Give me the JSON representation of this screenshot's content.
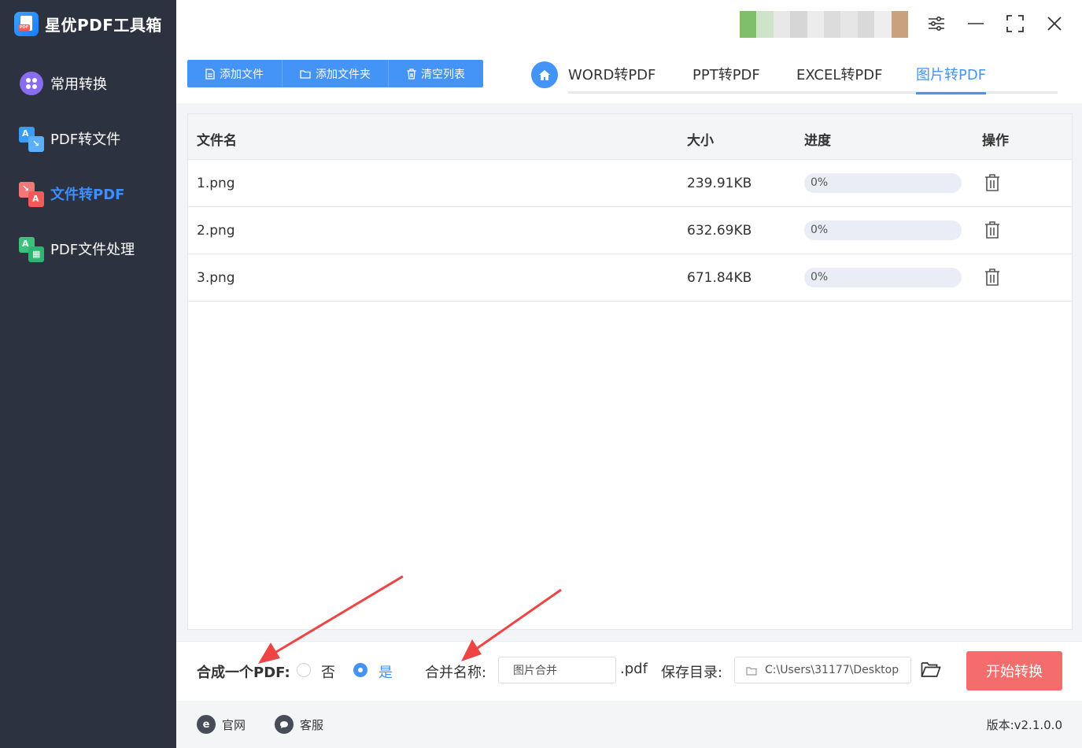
{
  "app": {
    "title": "星优PDF工具箱"
  },
  "sidebar": {
    "items": [
      {
        "label": "常用转换",
        "icon": "common-convert-icon",
        "active": false
      },
      {
        "label": "PDF转文件",
        "icon": "pdf-to-file-icon",
        "active": false
      },
      {
        "label": "文件转PDF",
        "icon": "file-to-pdf-icon",
        "active": true
      },
      {
        "label": "PDF文件处理",
        "icon": "pdf-process-icon",
        "active": false
      }
    ]
  },
  "toolbar": {
    "add_file": "添加文件",
    "add_folder": "添加文件夹",
    "clear_list": "清空列表"
  },
  "tabs": [
    {
      "label": "WORD转PDF",
      "active": false
    },
    {
      "label": "PPT转PDF",
      "active": false
    },
    {
      "label": "EXCEL转PDF",
      "active": false
    },
    {
      "label": "图片转PDF",
      "active": true
    }
  ],
  "table": {
    "headers": {
      "name": "文件名",
      "size": "大小",
      "progress": "进度",
      "action": "操作"
    },
    "rows": [
      {
        "name": "1.png",
        "size": "239.91KB",
        "progress_text": "0%",
        "progress": 0
      },
      {
        "name": "2.png",
        "size": "632.69KB",
        "progress_text": "0%",
        "progress": 0
      },
      {
        "name": "3.png",
        "size": "671.84KB",
        "progress_text": "0%",
        "progress": 0
      }
    ]
  },
  "settings": {
    "merge_label": "合成一个PDF:",
    "option_no": "否",
    "option_yes": "是",
    "selected": "是",
    "merge_name_label": "合并名称:",
    "merge_name_value": "图片合并",
    "ext": ".pdf",
    "save_dir_label": "保存目录:",
    "save_dir_value": "C:\\Users\\31177\\Desktop",
    "start_button": "开始转换"
  },
  "footer": {
    "website": "官网",
    "support": "客服",
    "version": "版本:v2.1.0.0"
  },
  "colors": {
    "sidebar_bg": "#2d3240",
    "accent": "#4493f7",
    "start_button": "#f56c6c",
    "annotation_arrow": "#ef4444"
  }
}
